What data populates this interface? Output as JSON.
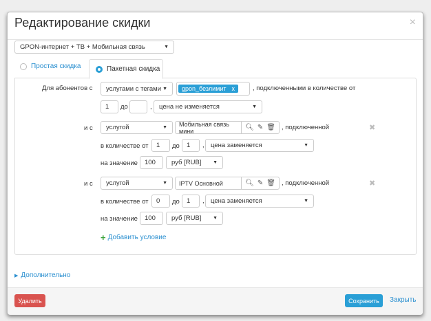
{
  "dialog": {
    "title": "Редактирование скидки",
    "close_icon": "×"
  },
  "package_select": "GPON-интернет + ТВ + Мобильная связь",
  "tabs": {
    "simple": "Простая скидка",
    "package": "Пакетная скидка",
    "active": "package"
  },
  "main": {
    "for_label": "Для абонентов с",
    "type_select": "услугами с тегами",
    "tag": "gpon_безлимит",
    "tag_remove": "x",
    "connected_text": ", подключенными в количестве от",
    "from": "1",
    "to_label": "до",
    "to": "",
    "comma": ",",
    "price_select": "цена не изменяется"
  },
  "conditions": [
    {
      "and_label": "и с",
      "type": "услугой",
      "service": "Мобильная связь мини",
      "connected": ", подключенной",
      "qty_label": "в количестве от",
      "from": "1",
      "to_label": "до",
      "to": "1",
      "comma": ",",
      "price": "цена заменяется",
      "value_label": "на значение",
      "value": "100",
      "currency": "руб [RUB]"
    },
    {
      "and_label": "и с",
      "type": "услугой",
      "service": "IPTV Основной",
      "connected": ", подключенной",
      "qty_label": "в количестве от",
      "from": "0",
      "to_label": "до",
      "to": "1",
      "comma": ",",
      "price": "цена заменяется",
      "value_label": "на значение",
      "value": "100",
      "currency": "руб [RUB]"
    }
  ],
  "add_condition": "Добавить условие",
  "advanced": "Дополнительно",
  "footer": {
    "delete": "Удалить",
    "save": "Сохранить",
    "close": "Закрыть"
  },
  "colors": {
    "accent": "#2a9fd6",
    "danger": "#d9534f",
    "tag": "#2a9fd6",
    "add": "#3ca33c"
  }
}
